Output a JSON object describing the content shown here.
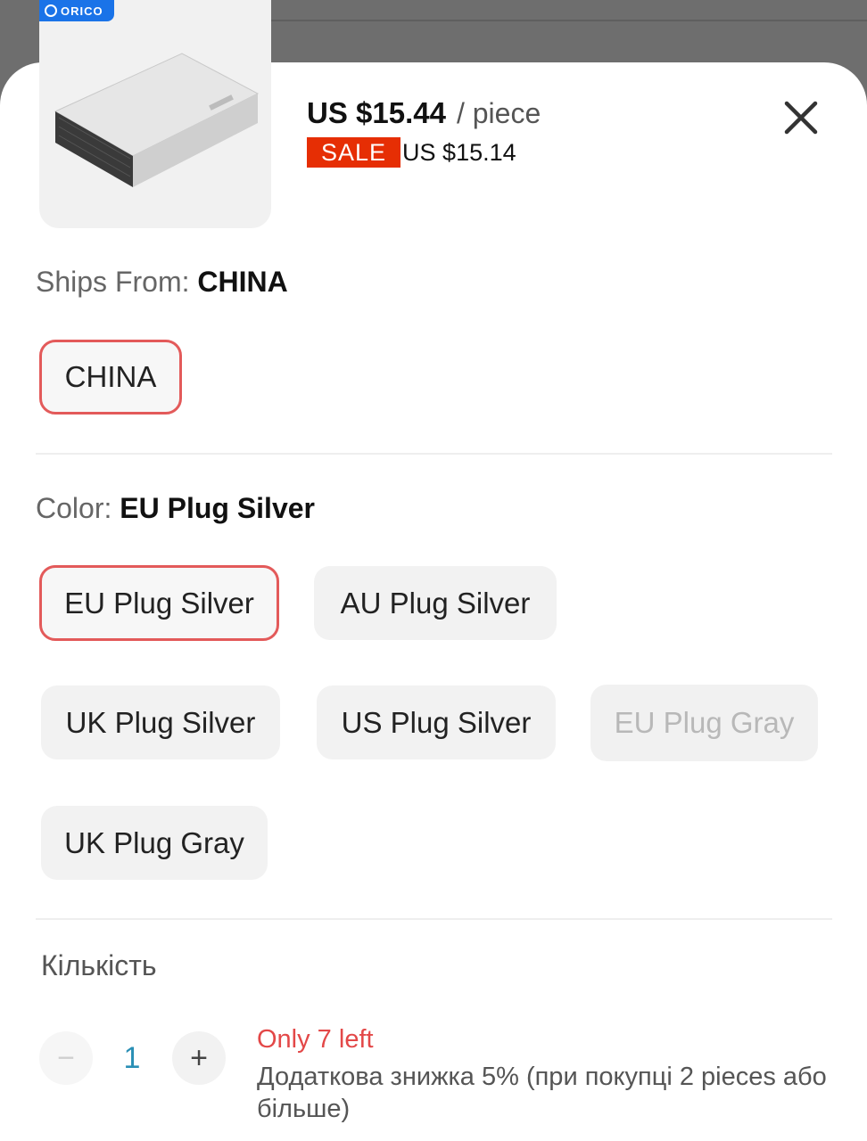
{
  "product": {
    "brand_badge": "ORICO",
    "price": "US $15.44",
    "unit": "/ piece",
    "sale_label": "SALE",
    "sale_price": "US $15.14"
  },
  "ships_from": {
    "label": "Ships From:",
    "selected": "CHINA",
    "options": [
      "CHINA"
    ]
  },
  "color": {
    "label": "Color:",
    "selected": "EU Plug Silver",
    "options": [
      {
        "label": "EU Plug Silver",
        "state": "selected"
      },
      {
        "label": "AU Plug Silver",
        "state": "available"
      },
      {
        "label": "UK Plug Silver",
        "state": "available"
      },
      {
        "label": "US Plug Silver",
        "state": "available"
      },
      {
        "label": "EU Plug Gray",
        "state": "disabled"
      },
      {
        "label": "UK Plug Gray",
        "state": "available"
      }
    ]
  },
  "quantity": {
    "label": "Кількість",
    "value": "1",
    "minus": "−",
    "plus": "+",
    "stock_note": "Only 7 left",
    "discount_note": "Додаткова знижка 5% (при покупці 2 pieces або більше)"
  },
  "colors": {
    "accent_red": "#e62e04",
    "selected_border": "#e35a5a",
    "quantity_value": "#2a8fb5"
  },
  "icons": [
    "close-icon",
    "minus-icon",
    "plus-icon"
  ]
}
